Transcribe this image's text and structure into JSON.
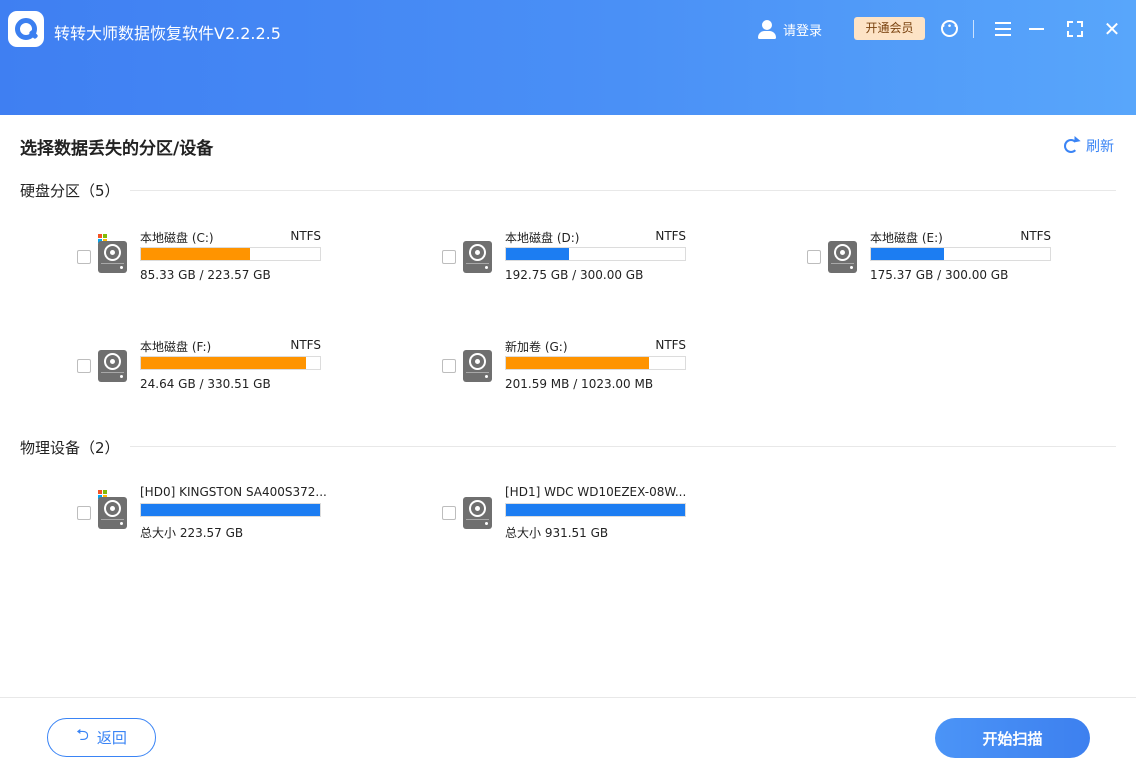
{
  "app": {
    "title": "转转大师数据恢复软件V2.2.2.5"
  },
  "header": {
    "login_label": "请登录",
    "vip_label": "开通会员"
  },
  "main": {
    "title": "选择数据丢失的分区/设备",
    "refresh_label": "刷新",
    "partitions_section": {
      "title": "硬盘分区",
      "count": "（5）"
    },
    "devices_section": {
      "title": "物理设备",
      "count": "（2）"
    },
    "partitions": [
      {
        "name": "本地磁盘   (C:)",
        "fs": "NTFS",
        "size": "85.33 GB / 223.57 GB",
        "usage": 0.61,
        "color": "#ff9400",
        "system": true
      },
      {
        "name": "本地磁盘   (D:)",
        "fs": "NTFS",
        "size": "192.75 GB / 300.00 GB",
        "usage": 0.35,
        "color": "#1c7df2",
        "system": false
      },
      {
        "name": "本地磁盘   (E:)",
        "fs": "NTFS",
        "size": "175.37 GB / 300.00 GB",
        "usage": 0.41,
        "color": "#1c7df2",
        "system": false
      },
      {
        "name": "本地磁盘   (F:)",
        "fs": "NTFS",
        "size": "24.64 GB / 330.51 GB",
        "usage": 0.92,
        "color": "#ff9400",
        "system": false
      },
      {
        "name": "新加卷   (G:)",
        "fs": "NTFS",
        "size": "201.59 MB / 1023.00 MB",
        "usage": 0.8,
        "color": "#ff9400",
        "system": false
      }
    ],
    "devices": [
      {
        "name": "[HD0] KINGSTON SA400S372...",
        "fs": "",
        "size": "总大小 223.57 GB",
        "usage": 1.0,
        "color": "#1c7df2",
        "system": true
      },
      {
        "name": "[HD1] WDC WD10EZEX-08W...",
        "fs": "",
        "size": "总大小 931.51 GB",
        "usage": 1.0,
        "color": "#1c7df2",
        "system": false
      }
    ]
  },
  "footer": {
    "back_label": "返回",
    "scan_label": "开始扫描"
  },
  "icons": {
    "windows_colors": [
      "#f35325",
      "#81bc06",
      "#05a6f0",
      "#ffba08"
    ]
  }
}
